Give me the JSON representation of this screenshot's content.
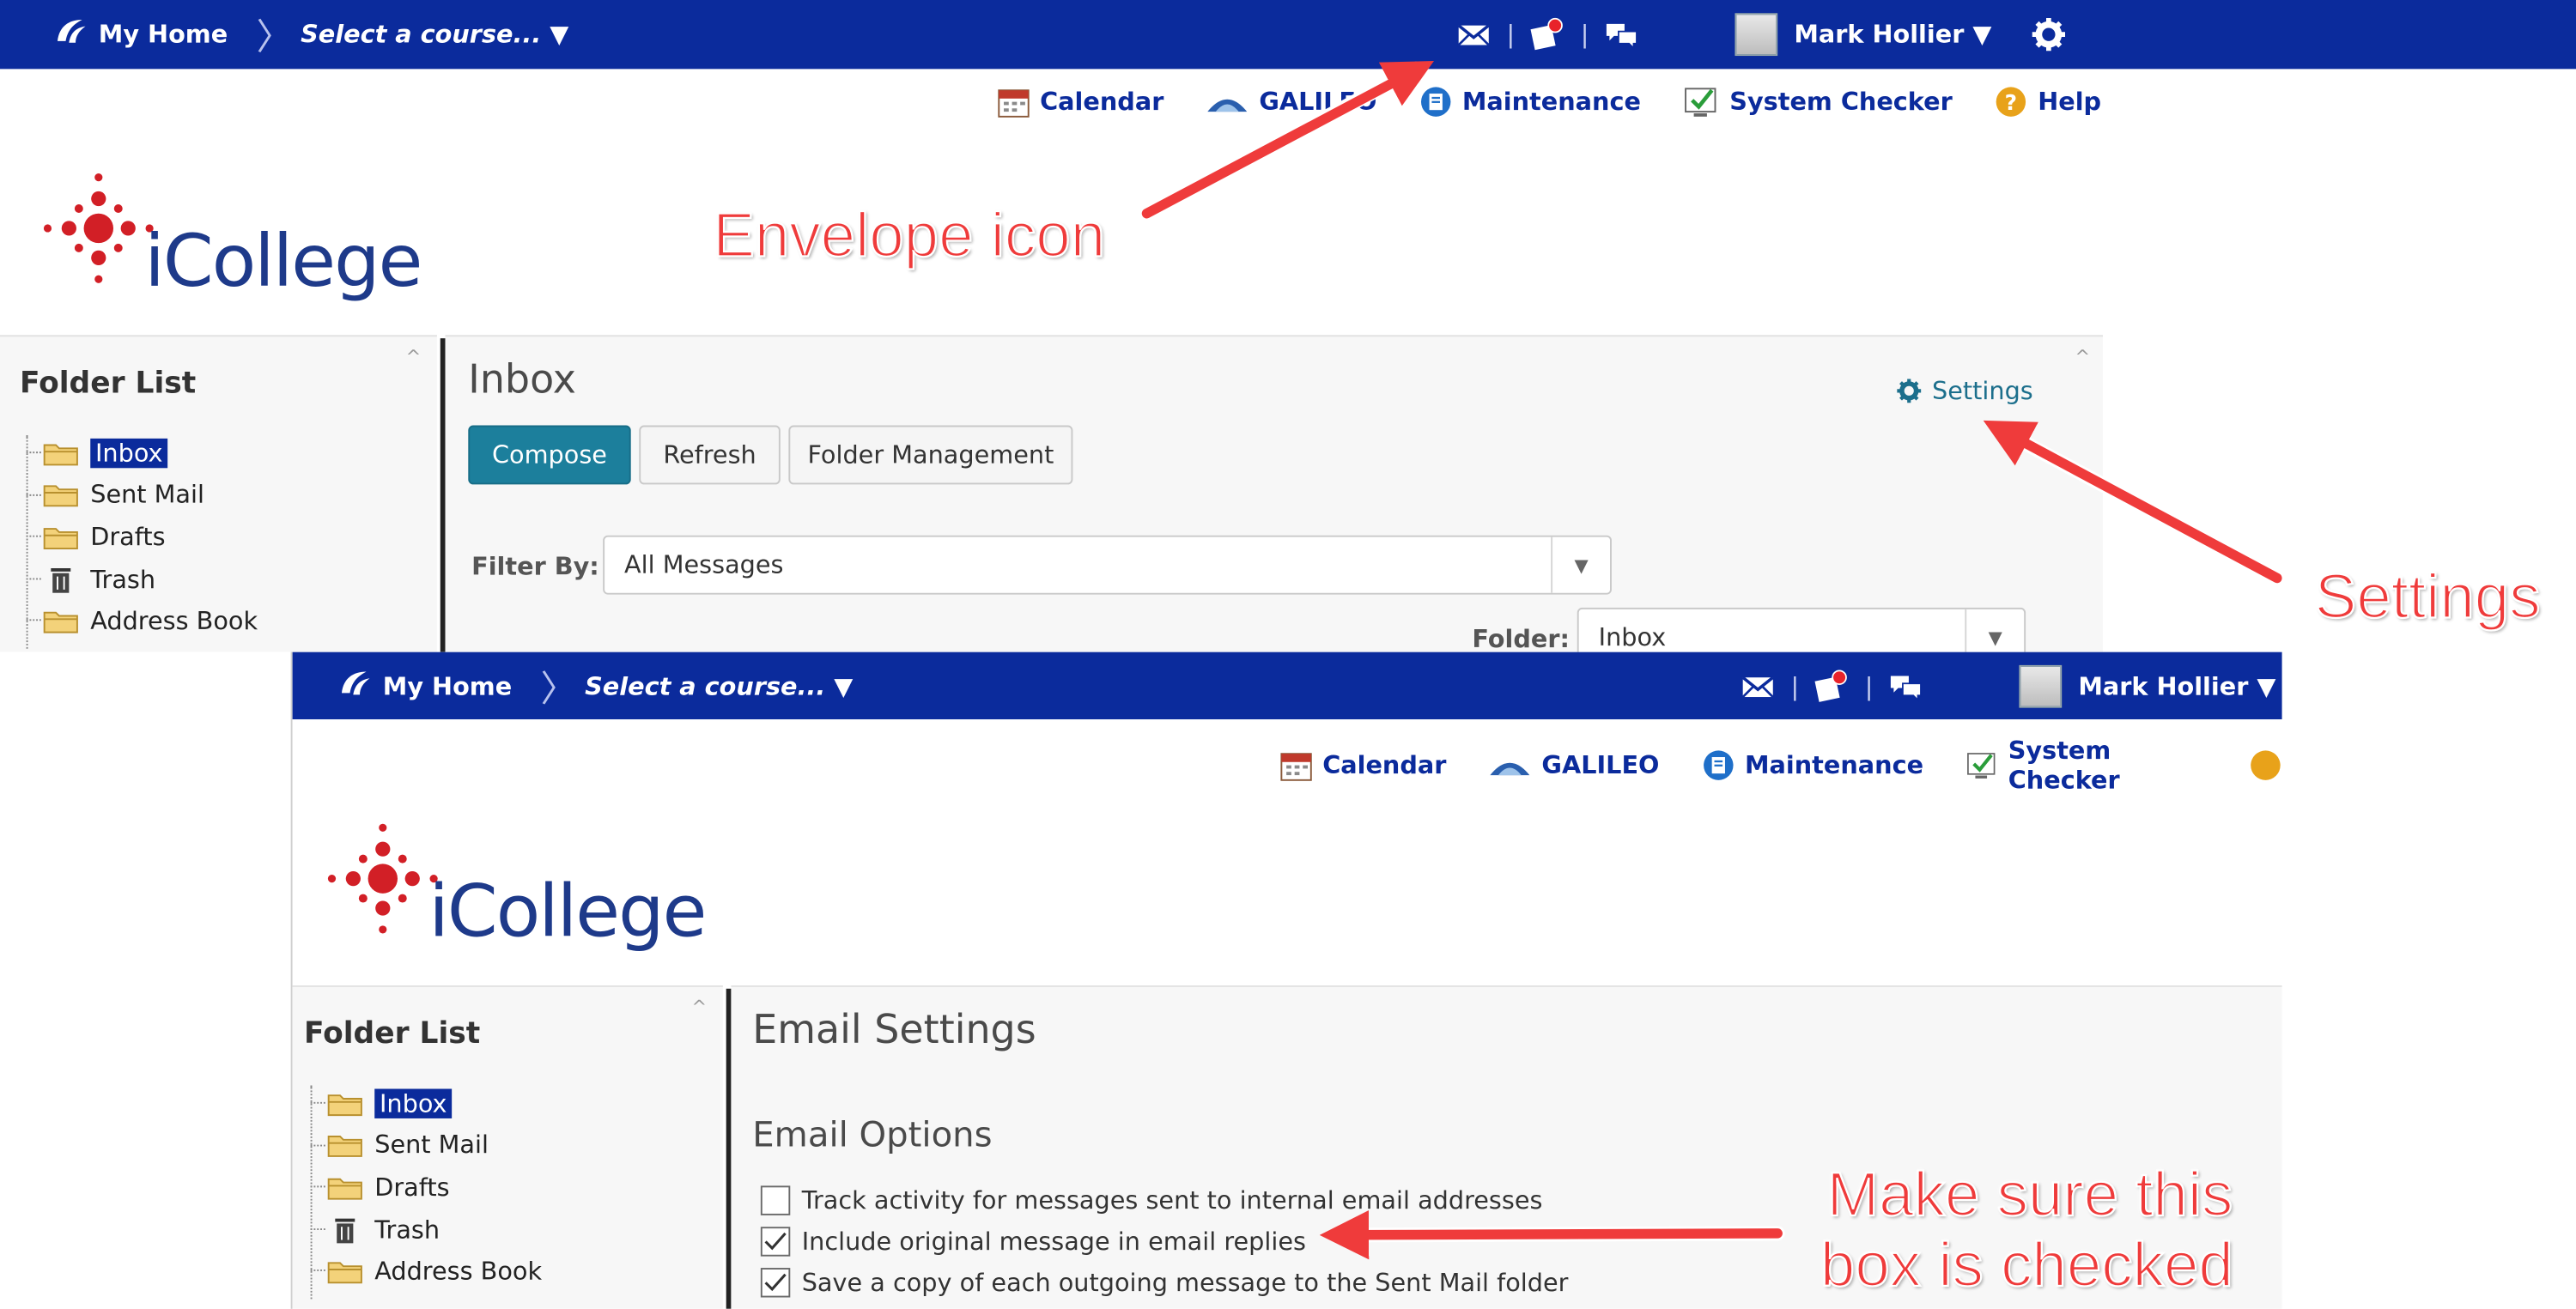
{
  "colors": {
    "navbar": "#0b2b9c",
    "link": "#0b2b9c",
    "primary_button": "#1c7f9c",
    "annotation": "#ef3b3b"
  },
  "screen1": {
    "navbar": {
      "home_label": "My Home",
      "course_select": "Select a course... ▼",
      "user_name": "Mark Hollier ▼",
      "icons": [
        "envelope-icon",
        "updates-icon",
        "chat-icon",
        "avatar",
        "gear-icon"
      ]
    },
    "minibar": {
      "calendar": "Calendar",
      "galileo": "GALILEO",
      "maintenance": "Maintenance",
      "system_checker": "System Checker",
      "help": "Help"
    },
    "logo_text": "iCollege",
    "folder_list": {
      "title": "Folder List",
      "items": [
        "Inbox",
        "Sent Mail",
        "Drafts",
        "Trash",
        "Address Book"
      ]
    },
    "inbox": {
      "title": "Inbox",
      "settings_link": "Settings",
      "buttons": {
        "compose": "Compose",
        "refresh": "Refresh",
        "folder_management": "Folder Management"
      },
      "filter_label": "Filter By:",
      "filter_value": "All Messages",
      "folder_label": "Folder:",
      "folder_value": "Inbox"
    }
  },
  "screen2": {
    "navbar": {
      "home_label": "My Home",
      "course_select": "Select a course... ▼",
      "user_name": "Mark Hollier ▼"
    },
    "minibar": {
      "calendar": "Calendar",
      "galileo": "GALILEO",
      "maintenance": "Maintenance",
      "system_checker": "System Checker"
    },
    "logo_text": "iCollege",
    "folder_list": {
      "title": "Folder List",
      "items": [
        "Inbox",
        "Sent Mail",
        "Drafts",
        "Trash",
        "Address Book"
      ]
    },
    "email_settings": {
      "title": "Email Settings",
      "section": "Email Options",
      "options": [
        {
          "label": "Track activity for messages sent to internal email addresses",
          "checked": false
        },
        {
          "label": "Include original message in email replies",
          "checked": true
        },
        {
          "label": "Save a copy of each outgoing message to the Sent Mail folder",
          "checked": true
        }
      ]
    }
  },
  "annotations": {
    "envelope": "Envelope icon",
    "settings": "Settings",
    "checkbox_line1": "Make sure this",
    "checkbox_line2": "box is checked"
  }
}
